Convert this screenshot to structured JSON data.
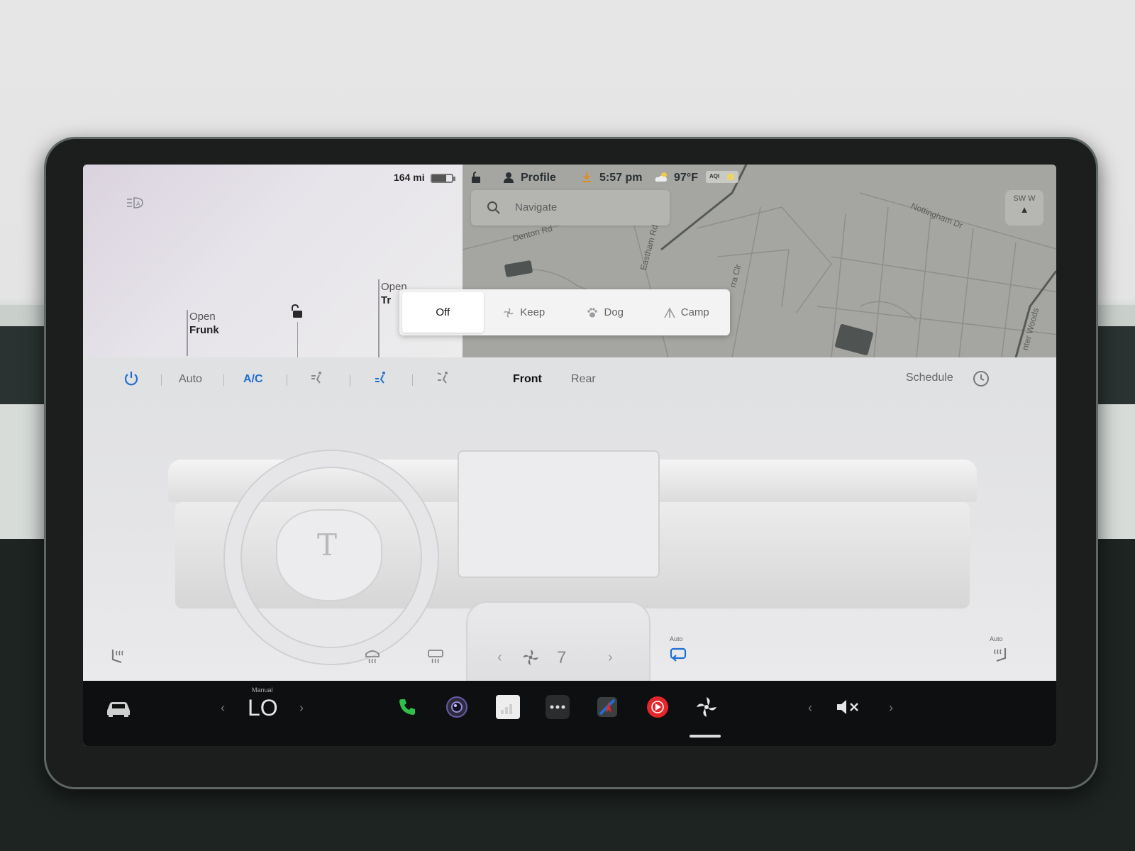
{
  "car_panel": {
    "range": "164 mi",
    "battery_level": 0.7,
    "frunk_line1": "Open",
    "frunk_line2": "Frunk",
    "trunk_line1": "Open",
    "trunk_line2": "Tr"
  },
  "status_bar": {
    "profile": "Profile",
    "time": "5:57 pm",
    "temperature": "97°F",
    "aqi": "AQI"
  },
  "map": {
    "search_placeholder": "Navigate",
    "compass": "SW  W",
    "roads": [
      "Denton Rd",
      "Eastham Rd",
      "Nottingham Dr",
      "rra Clr",
      "nter Woods"
    ]
  },
  "climate_keeper": {
    "options": [
      "Off",
      "Keep",
      "Dog",
      "Camp"
    ],
    "selected": "Off"
  },
  "climate_bar": {
    "auto": "Auto",
    "ac": "A/C",
    "front": "Front",
    "rear": "Rear",
    "schedule": "Schedule"
  },
  "climate_bottom": {
    "fan_speed": "7",
    "recirc_label": "Auto",
    "seat_right_label": "Auto"
  },
  "dock": {
    "temp_mode": "Manual",
    "temp_value": "LO"
  },
  "colors": {
    "accent_blue": "#1f6fd1",
    "phone_green": "#2fbf4a",
    "youtube_red": "#e5262b"
  }
}
